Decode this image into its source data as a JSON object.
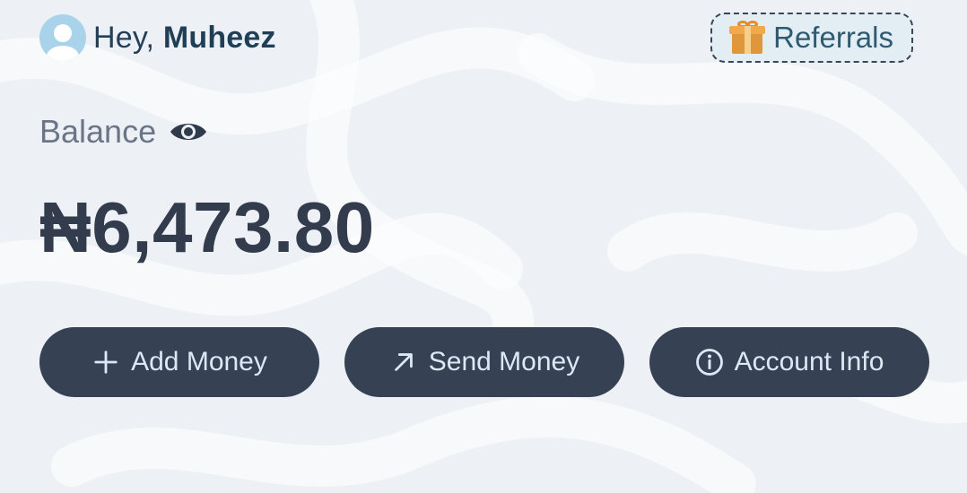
{
  "header": {
    "greeting_prefix": "Hey,",
    "user_name": "Muheez",
    "referrals_label": "Referrals"
  },
  "balance": {
    "label": "Balance",
    "amount": "₦6,473.80"
  },
  "actions": [
    {
      "label": "Add Money",
      "icon": "plus-icon"
    },
    {
      "label": "Send Money",
      "icon": "arrow-up-right-icon"
    },
    {
      "label": "Account Info",
      "icon": "info-icon"
    }
  ],
  "colors": {
    "background": "#edf1f5",
    "button": "#364254",
    "button_text": "#dbe9f4",
    "amount_text": "#333c4c",
    "referrals_bg": "#e2eef4"
  }
}
